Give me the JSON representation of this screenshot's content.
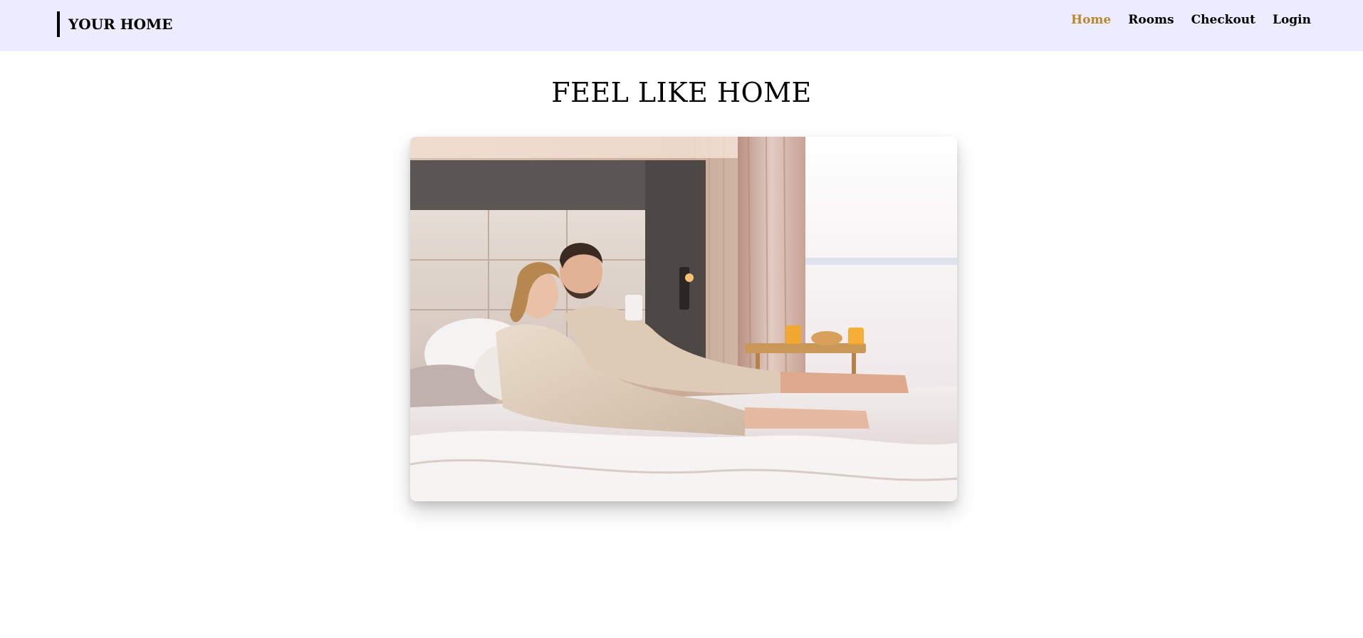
{
  "brand": {
    "name": "YOUR HOME"
  },
  "nav": {
    "items": [
      {
        "label": "Home",
        "active": true
      },
      {
        "label": "Rooms",
        "active": false
      },
      {
        "label": "Checkout",
        "active": false
      },
      {
        "label": "Login",
        "active": false
      }
    ]
  },
  "hero": {
    "headline": "FEEL LIKE HOME",
    "image_subject": "couple in bathrobes relaxing on hotel bed with breakfast tray"
  },
  "colors": {
    "header_bg": "#ecebff",
    "accent": "#b8892a",
    "text": "#000000"
  }
}
